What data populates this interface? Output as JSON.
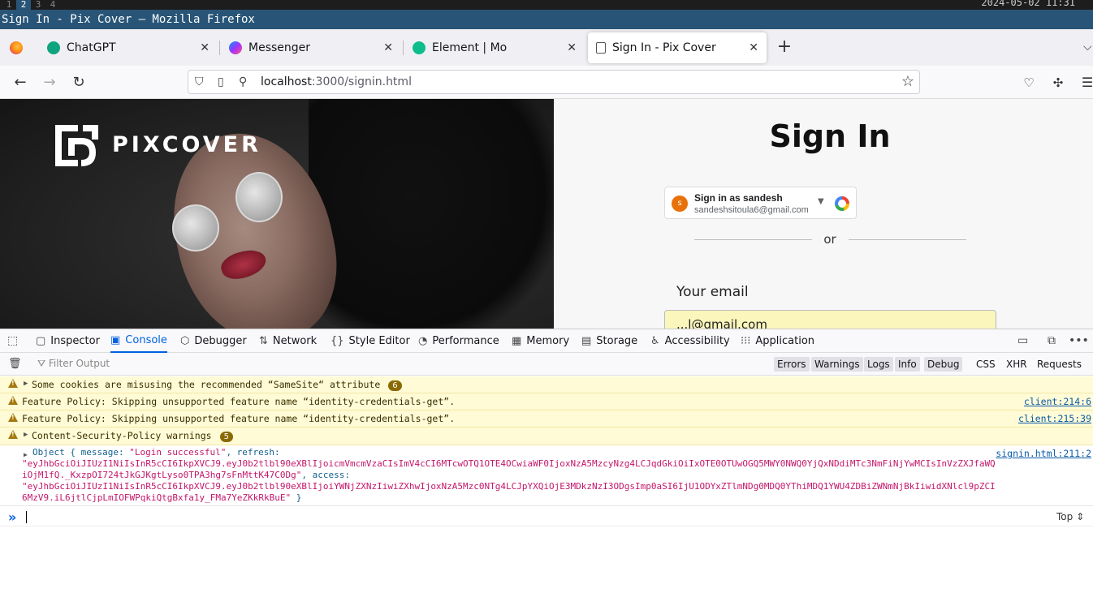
{
  "system": {
    "workspaces": [
      "1",
      "2",
      "3",
      "4"
    ],
    "active_workspace": "2",
    "clock": "2024-05-02 11:31"
  },
  "window": {
    "title": "Sign In - Pix Cover — Mozilla Firefox"
  },
  "tabs": [
    {
      "label": "ChatGPT",
      "favicon_color": "#10a37f"
    },
    {
      "label": "Messenger",
      "favicon_color": "#a033ff"
    },
    {
      "label": "Element | Mo",
      "favicon_color": "#0dbd8b"
    },
    {
      "label": "Sign In - Pix Cover",
      "favicon_color": "#555555",
      "selected": true
    }
  ],
  "url": {
    "host": "localhost",
    "rest": ":3000/signin.html"
  },
  "page": {
    "brand": "PIXCOVER",
    "title": "Sign In",
    "google": {
      "avatar_letter": "s",
      "name": "Sign in as sandesh",
      "email": "sandeshsitoula6@gmail.com"
    },
    "divider_text": "or",
    "email_label": "Your email",
    "email_value": "...l@gmail.com"
  },
  "devtools": {
    "tabs": [
      "Inspector",
      "Console",
      "Debugger",
      "Network",
      "Style Editor",
      "Performance",
      "Memory",
      "Storage",
      "Accessibility",
      "Application"
    ],
    "active_tab": "Console",
    "filter_placeholder": "Filter Output",
    "levels": [
      "Errors",
      "Warnings",
      "Logs",
      "Info",
      "Debug"
    ],
    "types": [
      "CSS",
      "XHR",
      "Requests"
    ],
    "messages": [
      {
        "text": "Some cookies are misusing the recommended “SameSite“ attribute",
        "count": "6",
        "expandable": true,
        "source": ""
      },
      {
        "text": "Feature Policy: Skipping unsupported feature name “identity-credentials-get”.",
        "source": "client:214:6"
      },
      {
        "text": "Feature Policy: Skipping unsupported feature name “identity-credentials-get”.",
        "source": "client:215:39"
      },
      {
        "text": "Content-Security-Policy warnings",
        "count": "5",
        "expandable": true,
        "source": ""
      }
    ],
    "log": {
      "source": "signin.html:211:2",
      "line1_prefix": "Object { message: ",
      "message_value": "\"Login successful\"",
      "line1_mid": ", refresh:",
      "refresh_value_1": "\"eyJhbGciOiJIUzI1NiIsInR5cCI6IkpXVCJ9.eyJ0b2tlbl90eXBlIjoicmVmcmVzaCIsImV4cCI6MTcwOTQ1OTE4OCwiaWF0IjoxNzA5MzcyNzg4LCJqdGkiOiIxOTE0OTUwOGQ5MWY0NWQ0YjQxNDdiMTc3NmFiNjYwMCIsInVzZXJfaWQ",
      "refresh_value_2": "iOjM1fQ._KxzpOI724tJkGJKgtLyso0TPA3hg7sFnMttK47C0Dg\"",
      "line3_mid": ", access:",
      "access_value_1": "\"eyJhbGciOiJIUzI1NiIsInR5cCI6IkpXVCJ9.eyJ0b2tlbl90eXBlIjoiYWNjZXNzIiwiZXhwIjoxNzA5Mzc0NTg4LCJpYXQiOjE3MDkzNzI3ODgsImp0aSI6IjU1ODYxZTlmNDg0MDQ0YThiMDQ1YWU4ZDBiZWNmNjBkIiwidXNlcl9pZCI",
      "access_value_2": "6MzV9.iL6jtlCjpLmIOFWPqkiQtgBxfa1y_FMa7YeZKkRkBuE\"",
      "line5_suffix": " }"
    },
    "context_selector": "Top ⇕"
  }
}
